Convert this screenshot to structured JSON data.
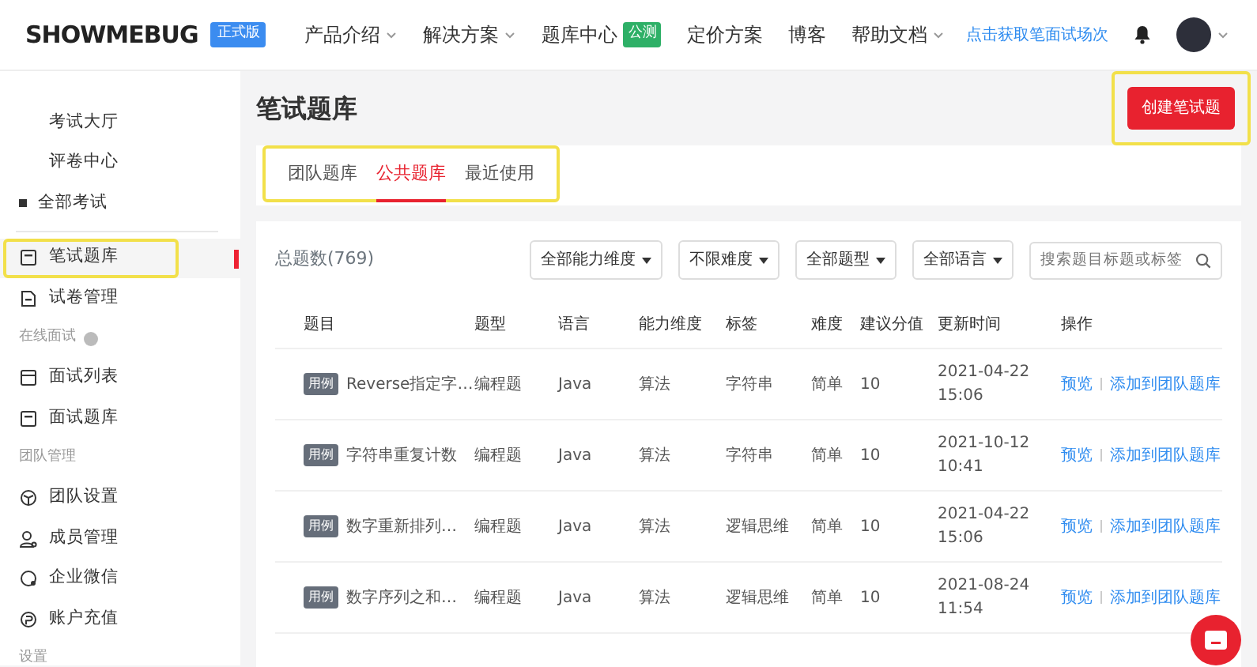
{
  "header": {
    "logo": "SHOWMEBUG",
    "edition_badge": "正式版",
    "nav": [
      {
        "label": "产品介绍",
        "dropdown": true
      },
      {
        "label": "解决方案",
        "dropdown": true
      },
      {
        "label": "题库中心",
        "dropdown": false,
        "badge": "公测"
      },
      {
        "label": "定价方案",
        "dropdown": false
      },
      {
        "label": "博客",
        "dropdown": false
      },
      {
        "label": "帮助文档",
        "dropdown": true
      }
    ],
    "promo_link": "点击获取笔面试场次"
  },
  "sidebar": {
    "items": [
      {
        "kind": "sub",
        "label": "考试大厅",
        "selected": false
      },
      {
        "kind": "sub",
        "label": "评卷中心",
        "selected": false
      },
      {
        "kind": "bullet",
        "label": "全部考试",
        "selected": false
      },
      {
        "kind": "divider"
      },
      {
        "kind": "item",
        "label": "笔试题库",
        "selected": true,
        "highlighted": true
      },
      {
        "kind": "item",
        "label": "试卷管理",
        "selected": false
      },
      {
        "kind": "section",
        "label": "在线面试",
        "help": true
      },
      {
        "kind": "item",
        "label": "面试列表",
        "selected": false
      },
      {
        "kind": "item",
        "label": "面试题库",
        "selected": false
      },
      {
        "kind": "section",
        "label": "团队管理",
        "help": false
      },
      {
        "kind": "item",
        "label": "团队设置",
        "selected": false
      },
      {
        "kind": "item",
        "label": "成员管理",
        "selected": false
      },
      {
        "kind": "item",
        "label": "企业微信",
        "selected": false
      },
      {
        "kind": "item",
        "label": "账户充值",
        "selected": false
      },
      {
        "kind": "section",
        "label": "设置",
        "help": false
      }
    ]
  },
  "page": {
    "title": "笔试题库",
    "create_button": {
      "label": "创建笔试题",
      "highlighted": true
    },
    "tabs_highlighted": true,
    "tabs": [
      {
        "label": "团队题库",
        "selected": false
      },
      {
        "label": "公共题库",
        "selected": true
      },
      {
        "label": "最近使用",
        "selected": false
      }
    ],
    "total": "总题数(769)",
    "filters": [
      "全部能力维度",
      "不限难度",
      "全部题型",
      "全部语言"
    ],
    "search": {
      "placeholder": "搜索题目标题或标签"
    },
    "table": {
      "columns": [
        "题目",
        "题型",
        "语言",
        "能力维度",
        "标签",
        "难度",
        "建议分值",
        "更新时间",
        "操作"
      ],
      "rows": [
        {
          "tag": "用例",
          "title": "Reverse指定字…",
          "type": "编程题",
          "language": "Java",
          "ability": "算法",
          "label": "字符串",
          "difficulty": "简单",
          "score": "10",
          "date": "2021-04-22",
          "time": "15:06",
          "actions": [
            "预览",
            "添加到团队题库"
          ]
        },
        {
          "tag": "用例",
          "title": "字符串重复计数",
          "type": "编程题",
          "language": "Java",
          "ability": "算法",
          "label": "字符串",
          "difficulty": "简单",
          "score": "10",
          "date": "2021-10-12",
          "time": "10:41",
          "actions": [
            "预览",
            "添加到团队题库"
          ]
        },
        {
          "tag": "用例",
          "title": "数字重新排列…",
          "type": "编程题",
          "language": "Java",
          "ability": "算法",
          "label": "逻辑思维",
          "difficulty": "简单",
          "score": "10",
          "date": "2021-04-22",
          "time": "15:06",
          "actions": [
            "预览",
            "添加到团队题库"
          ]
        },
        {
          "tag": "用例",
          "title": "数字序列之和…",
          "type": "编程题",
          "language": "Java",
          "ability": "算法",
          "label": "逻辑思维",
          "difficulty": "简单",
          "score": "10",
          "date": "2021-08-24",
          "time": "11:54",
          "actions": [
            "预览",
            "添加到团队题库"
          ]
        }
      ]
    }
  }
}
